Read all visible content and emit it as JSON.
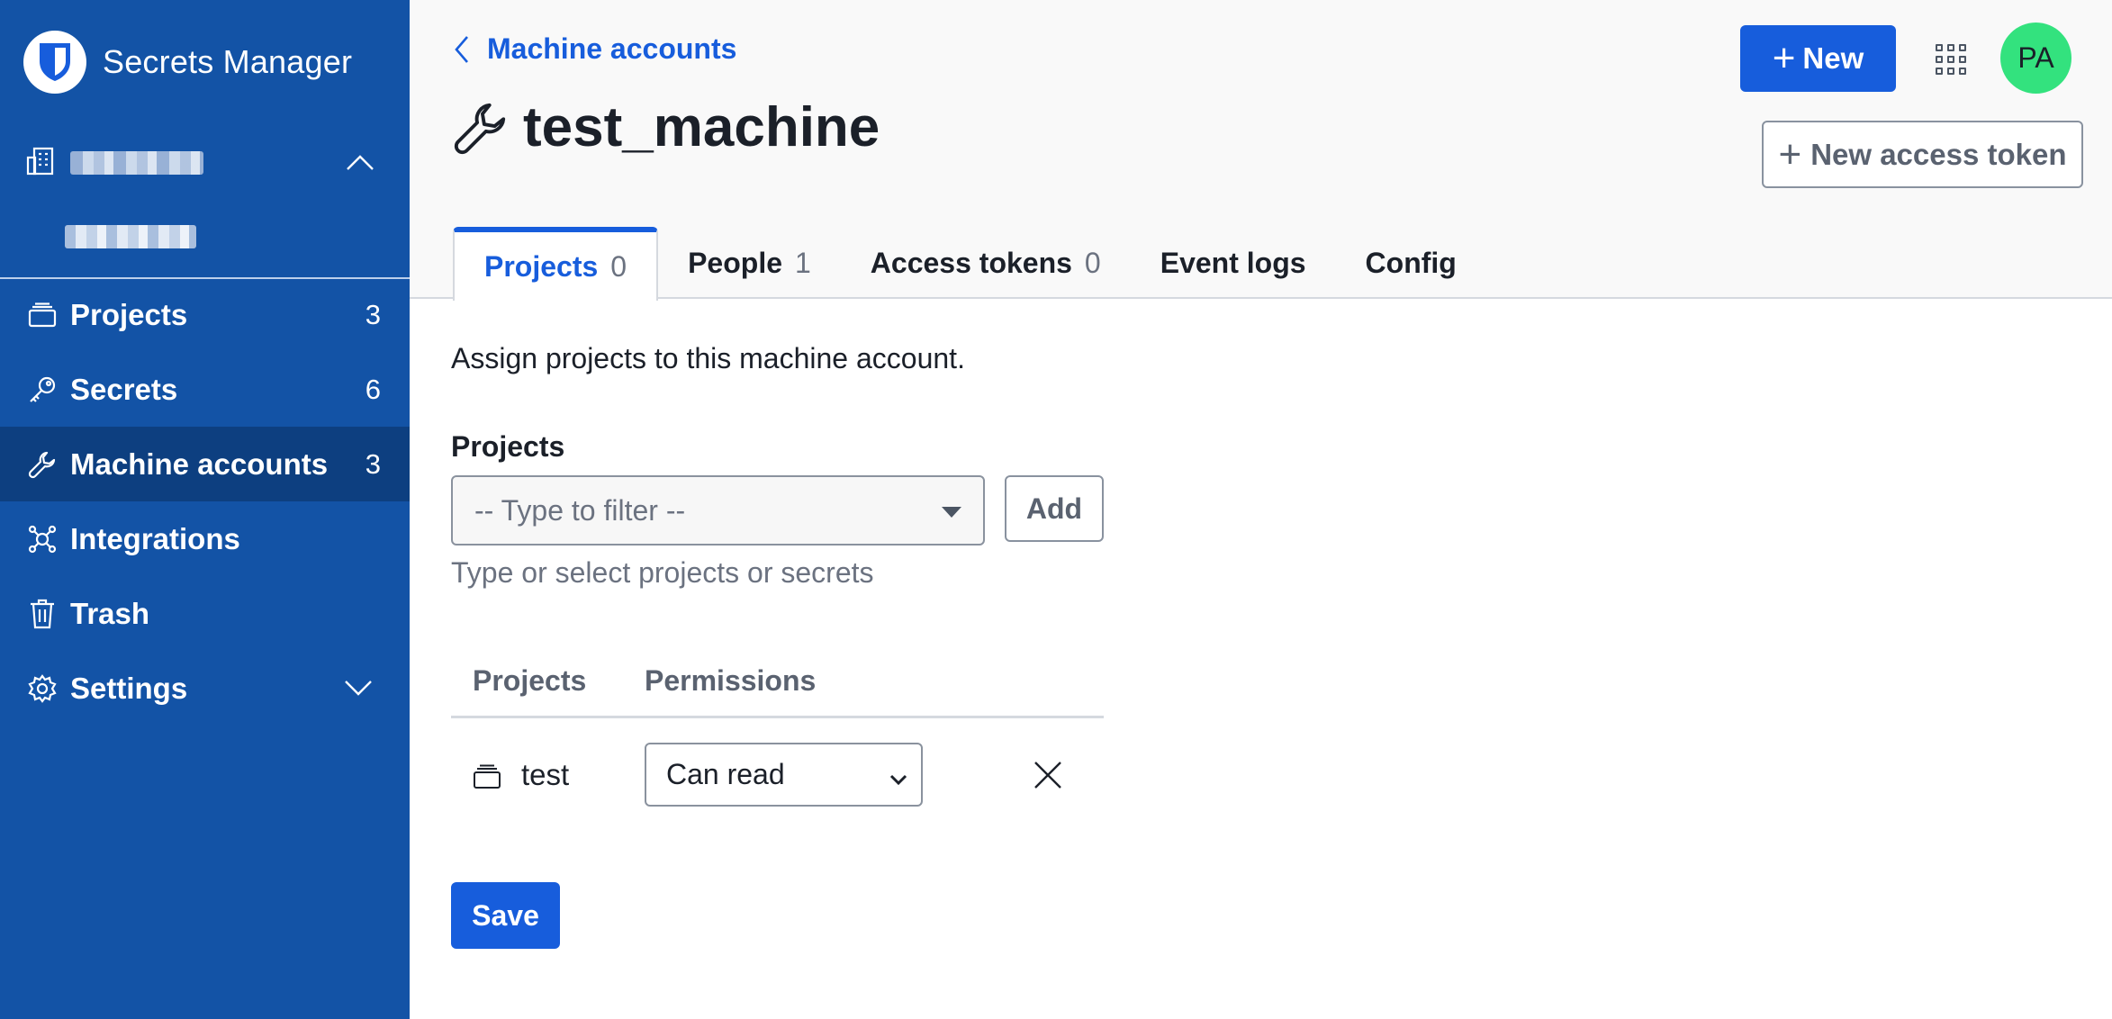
{
  "app": {
    "name": "Secrets Manager"
  },
  "sidebar": {
    "items": [
      {
        "label": "Projects",
        "count": "3"
      },
      {
        "label": "Secrets",
        "count": "6"
      },
      {
        "label": "Machine accounts",
        "count": "3"
      },
      {
        "label": "Integrations"
      },
      {
        "label": "Trash"
      },
      {
        "label": "Settings"
      }
    ]
  },
  "header": {
    "breadcrumb": "Machine accounts",
    "title": "test_machine",
    "new_button": "New",
    "new_token_button": "New access token",
    "avatar_initials": "PA"
  },
  "tabs": [
    {
      "label": "Projects",
      "count": "0"
    },
    {
      "label": "People",
      "count": "1"
    },
    {
      "label": "Access tokens",
      "count": "0"
    },
    {
      "label": "Event logs"
    },
    {
      "label": "Config"
    }
  ],
  "main": {
    "description": "Assign projects to this machine account.",
    "field_label": "Projects",
    "filter_placeholder": "-- Type to filter --",
    "add_button": "Add",
    "hint": "Type or select projects or secrets",
    "table": {
      "columns": [
        "Projects",
        "Permissions"
      ],
      "rows": [
        {
          "project": "test",
          "permission": "Can read"
        }
      ]
    },
    "save_button": "Save"
  },
  "colors": {
    "sidebar": "#1353a6",
    "sidebar_active": "#0d3f80",
    "primary": "#175ddc",
    "avatar": "#33e27e"
  }
}
